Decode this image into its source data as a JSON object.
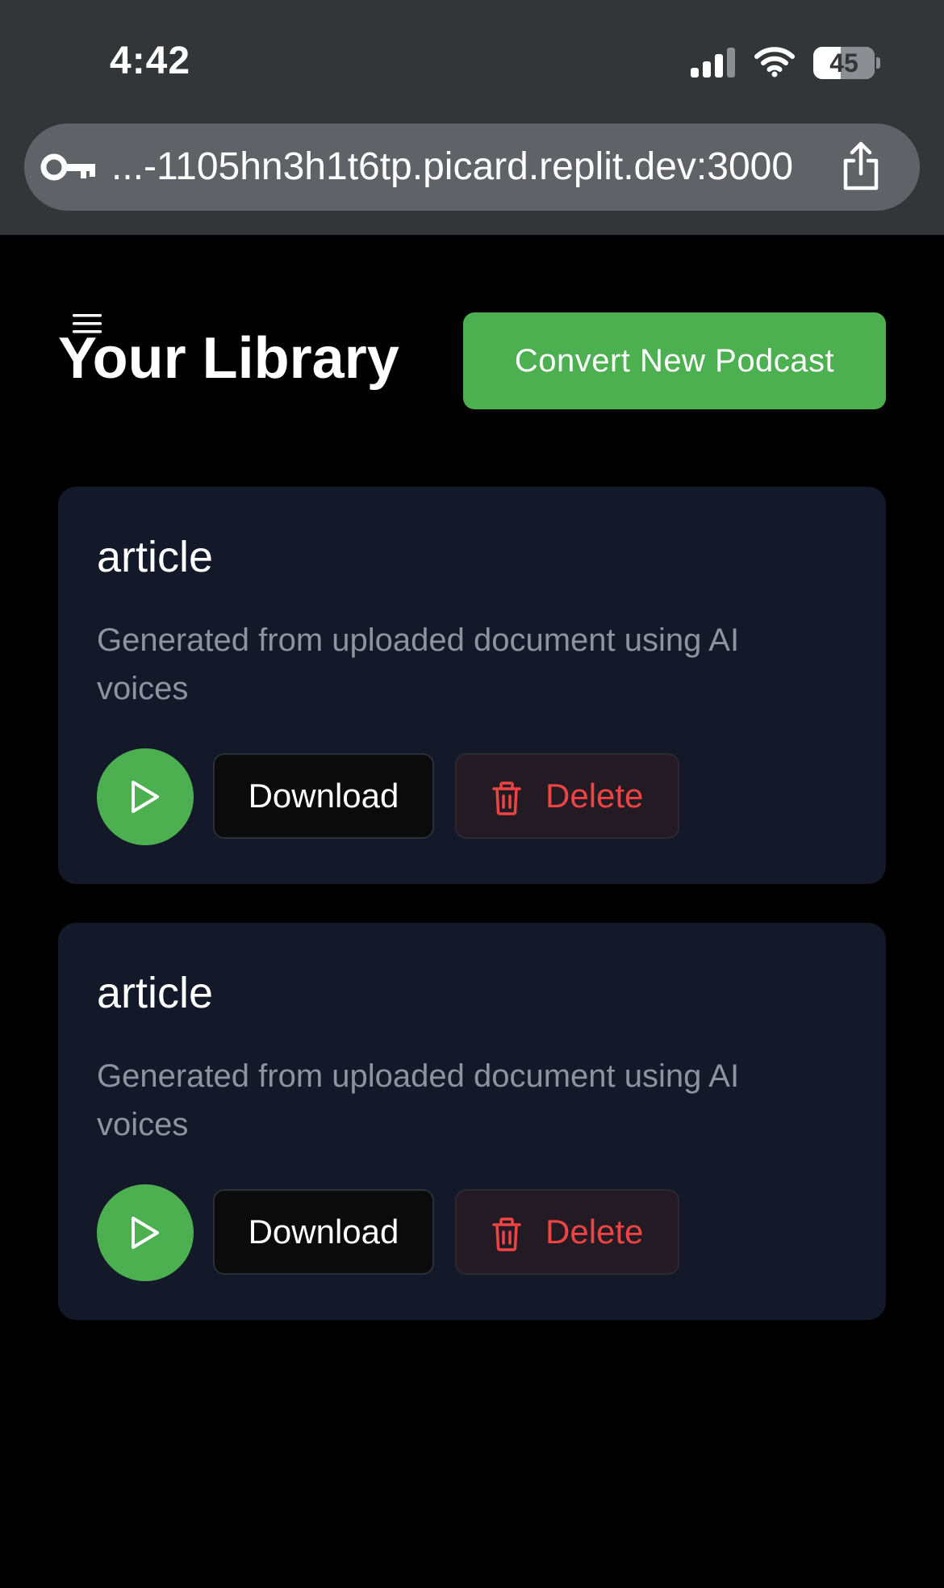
{
  "status_bar": {
    "time": "4:42",
    "battery_level": "45",
    "battery_percent": 45,
    "icons": [
      "signal-icon",
      "wifi-icon",
      "battery-icon"
    ]
  },
  "browser": {
    "url": "...-1105hn3h1t6tp.picard.replit.dev:3000",
    "icons": [
      "key-icon",
      "share-icon"
    ]
  },
  "header": {
    "title": "Your Library",
    "convert_label": "Convert New Podcast",
    "menu_icon": "hamburger-menu-icon"
  },
  "podcasts": [
    {
      "title": "article",
      "description": "Generated from uploaded document using AI voices",
      "download_label": "Download",
      "delete_label": "Delete"
    },
    {
      "title": "article",
      "description": "Generated from uploaded document using AI voices",
      "download_label": "Download",
      "delete_label": "Delete"
    }
  ],
  "colors": {
    "accent": "#4caf50",
    "card": "#131928",
    "danger": "#ef4444",
    "muted_text": "#8e93a0",
    "chrome": "#333639",
    "url_bar": "#5f6368"
  }
}
